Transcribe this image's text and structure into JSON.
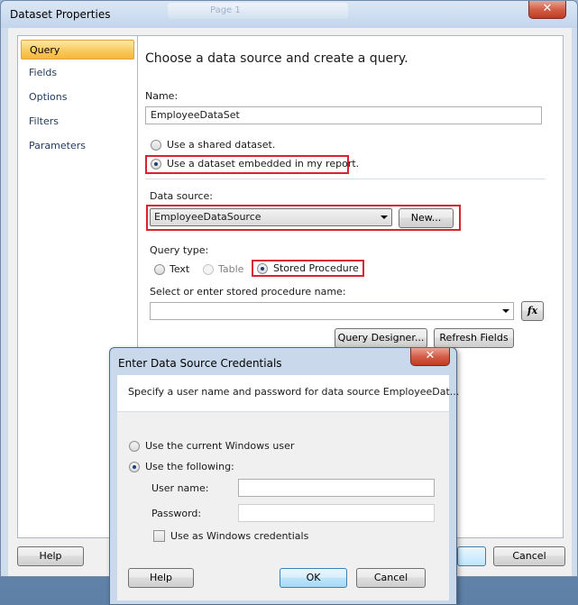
{
  "main_dialog": {
    "title": "Dataset Properties",
    "title_ghost": "Page 1",
    "close_glyph": "✕",
    "nav_items": [
      "Query",
      "Fields",
      "Options",
      "Filters",
      "Parameters"
    ],
    "selected_nav": "Query",
    "heading": "Choose a data source and create a query.",
    "name_label": "Name:",
    "name_value": "EmployeeDataSet",
    "radio_shared": "Use a shared dataset.",
    "radio_embedded": "Use a dataset embedded in my report.",
    "data_source_label": "Data source:",
    "data_source_value": "EmployeeDataSource",
    "new_button": "New...",
    "query_type_label": "Query type:",
    "query_types": [
      "Text",
      "Table",
      "Stored Procedure"
    ],
    "selected_query_type": "Stored Procedure",
    "sp_label": "Select or enter stored procedure name:",
    "sp_value": "",
    "fx_label": "fx",
    "query_designer_button": "Query Designer...",
    "refresh_fields_button": "Refresh Fields",
    "help_button": "Help",
    "cancel_button": "Cancel",
    "highlight_color": "#d9232e"
  },
  "cred_dialog": {
    "title": "Enter Data Source Credentials",
    "close_glyph": "✕",
    "description": "Specify a user name and password for data source EmployeeDat...",
    "radio_windows": "Use the current Windows user",
    "radio_following": "Use the following:",
    "user_name_label": "User name:",
    "user_name_value": "",
    "password_label": "Password:",
    "password_value": "",
    "checkbox_label": "Use as Windows credentials",
    "checkbox_checked": false,
    "help_button": "Help",
    "ok_button": "OK",
    "cancel_button": "Cancel"
  }
}
